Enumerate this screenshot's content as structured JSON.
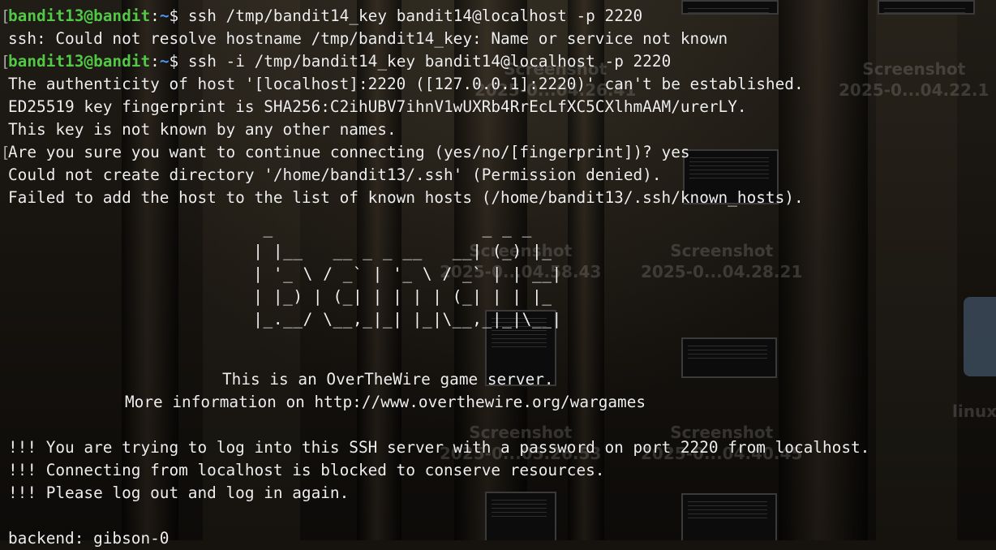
{
  "desktop": {
    "ghost_labels": [
      {
        "title": "Screenshot",
        "date": "2025-0...04.26.41"
      },
      {
        "title": "Screenshot",
        "date": "2025-0...04.22.1"
      },
      {
        "title": "Screenshot",
        "date": "2025-0...04.58.43"
      },
      {
        "title": "Screenshot",
        "date": "2025-0...04.28.21"
      },
      {
        "title": "Screenshot",
        "date": "2025-0...05.26.53"
      },
      {
        "title": "Screenshot",
        "date": "2025-0...04.40.45"
      }
    ],
    "folder_label": "linux"
  },
  "terminal": {
    "prompt_user": "bandit13@bandit",
    "prompt_colon": ":",
    "prompt_path": "~",
    "prompt_symbol": "$",
    "cmd1": " ssh /tmp/bandit14_key bandit14@localhost -p 2220",
    "out1": "ssh: Could not resolve hostname /tmp/bandit14_key: Name or service not known",
    "cmd2": " ssh -i /tmp/bandit14_key bandit14@localhost -p 2220",
    "auth1": "The authenticity of host '[localhost]:2220 ([127.0.0.1]:2220)' can't be established.",
    "auth2": "ED25519 key fingerprint is SHA256:C2ihUBV7ihnV1wUXRb4RrEcLfXC5CXlhmAAM/urerLY.",
    "auth3": "This key is not known by any other names.",
    "auth4": "Are you sure you want to continue connecting (yes/no/[fingerprint])? yes",
    "auth5": "Could not create directory '/home/bandit13/.ssh' (Permission denied).",
    "auth6": "Failed to add the host to the list of known hosts (/home/bandit13/.ssh/known_hosts).",
    "banner_ascii": [
      "  _                     _ _ _   ",
      " | |__   __ _ _ __   __| (_) |_ ",
      " | '_ \\ / _` | '_ \\ / _` | | __|",
      " | |_) | (_| | | | | (_| | | |_ ",
      " |_.__/ \\__,_|_| |_|\\__,_|_|\\__|"
    ],
    "motd1": "This is an OverTheWire game server.",
    "motd2": "More information on http://www.overthewire.org/wargames",
    "warn1": "!!! You are trying to log into this SSH server with a password on port 2220 from localhost.",
    "warn2": "!!! Connecting from localhost is blocked to conserve resources.",
    "warn3": "!!! Please log out and log in again.",
    "backend": "backend: gibson-0",
    "bracket_marker": "["
  }
}
